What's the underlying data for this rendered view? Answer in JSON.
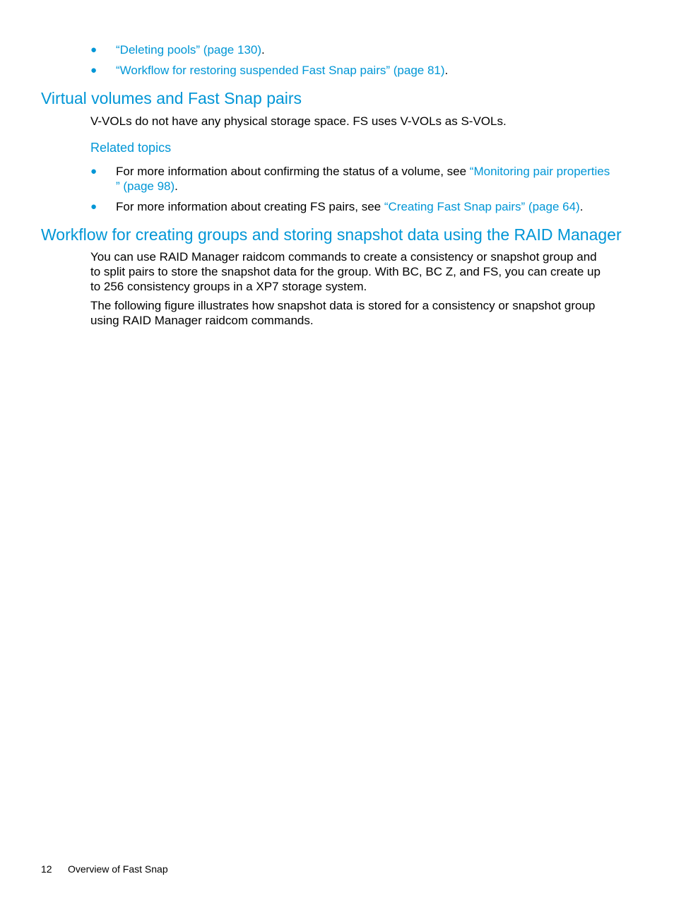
{
  "top_bullets": [
    {
      "link": "“Deleting pools” (page 130)",
      "suffix": "."
    },
    {
      "link": "“Workflow for restoring suspended Fast Snap pairs” (page 81)",
      "suffix": "."
    }
  ],
  "section1": {
    "heading": "Virtual volumes and Fast Snap pairs",
    "body": "V-VOLs do not have any physical storage space. FS uses V-VOLs as S-VOLs.",
    "related_heading": "Related topics",
    "related": [
      {
        "prefix": "For more information about confirming the status of a volume, see ",
        "link_line1": "“Monitoring pair properties",
        "link_line2": "” (page 98)",
        "suffix": "."
      },
      {
        "prefix": "For more information about creating FS pairs, see ",
        "link": "“Creating Fast Snap pairs” (page 64)",
        "suffix": "."
      }
    ]
  },
  "section2": {
    "heading": "Workflow for creating groups and storing snapshot data using the RAID Manager",
    "para1_lines": [
      "You can use RAID Manager raidcom commands to create a consistency or snapshot group and",
      "to split pairs to store the snapshot data for the group. With BC, BC Z, and FS, you can create up",
      "to 256 consistency groups in a XP7 storage system."
    ],
    "para2_lines": [
      "The following figure illustrates how snapshot data is stored for a consistency or snapshot group",
      "using RAID Manager raidcom commands."
    ]
  },
  "footer": {
    "page_number": "12",
    "chapter_title": "Overview of Fast Snap"
  },
  "colors": {
    "accent": "#0096d6",
    "text": "#000000"
  }
}
